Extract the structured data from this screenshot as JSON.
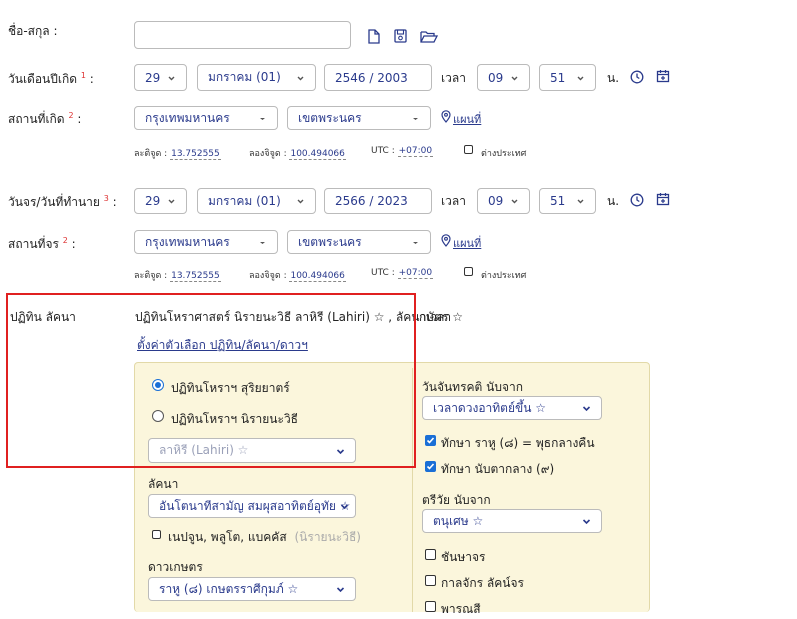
{
  "fullname": {
    "label": "ชื่อ-สกุล :",
    "value": ""
  },
  "birth": {
    "label": "วันเดือนปีเกิด",
    "req": "1",
    "day": "29",
    "month": "มกราคม (01)",
    "year": "2546 / 2003",
    "time_label": "เวลา",
    "hour": "09",
    "minute": "51",
    "unit": "น."
  },
  "birth_place": {
    "label": "สถานที่เกิด",
    "req": "2",
    "province": "กรุงเทพมหานคร",
    "district": "เขตพระนคร",
    "map_link": "แผนที่",
    "lat_label": "ละติจูด :",
    "lat": "13.752555",
    "lon_label": "ลองจิจูด :",
    "lon": "100.494066",
    "utc_label": "UTC :",
    "utc": "+07:00",
    "abroad": "ต่างประเทศ"
  },
  "transit": {
    "label": "วันจร/วันที่ทำนาย",
    "req": "3",
    "day": "29",
    "month": "มกราคม (01)",
    "year": "2566 / 2023",
    "time_label": "เวลา",
    "hour": "09",
    "minute": "51",
    "unit": "น."
  },
  "transit_place": {
    "label": "สถานที่จร",
    "req": "2",
    "province": "กรุงเทพมหานคร",
    "district": "เขตพระนคร",
    "map_link": "แผนที่",
    "lat_label": "ละติจูด :",
    "lat": "13.752555",
    "lon_label": "ลองจิจูด :",
    "lon": "100.494066",
    "utc_label": "UTC :",
    "utc": "+07:00",
    "abroad": "ต่างประเทศ"
  },
  "calendar": {
    "label": "ปฏิทิน ลัคนา",
    "summary": "ปฏิทินโหราศาสตร์ นิรายนะวิธี ลาหิรี (Lahiri) ☆ , ลัคนาเวลาฤกษ์ ☆",
    "summary_left": "ปฏิทินโหราศาสตร์ นิรายนะวิธี ลาหิรี (Lahiri) ☆ , ลัคนาเวลา",
    "summary_right": "กษัตร ☆",
    "settings_link": "ตั้งค่าตัวเลือก ปฏิทิน/ลัคนา/ดาวฯ",
    "radio_tropical": "ปฏิทินโหราฯ สุริยยาตร์",
    "radio_sidereal": "ปฏิทินโหราฯ นิรายนะวิธี",
    "ayanamsa": "ลาหิรี (Lahiri) ☆",
    "ascendant_label": "ลัคนา",
    "ascendant": "อันโตนาทีสามัญ สมผุสอาทิตย์อุทัย ☆",
    "outer_planets": "เนปจูน, พลูโต, แบคคัส",
    "outer_planets_note": "(นิรายนะวิธี)",
    "nakshatra_label": "ดาวเกษตร",
    "nakshatra": "ราหู (๘) เกษตรราศีกุมภ์ ☆"
  },
  "right_panel": {
    "tithi_label": "วันจันทรคติ นับจาก",
    "tithi": "เวลาดวงอาทิตย์ขึ้น ☆",
    "rahu_check": "ทักษา ราหู (๘) = พุธกลางคืน",
    "count_check": "ทักษา นับตากลาง (๙)",
    "trivai_label": "ตรีวัย นับจาก",
    "trivai": "ตนุเศษ ☆",
    "cb1": "ชันษาจร",
    "cb2": "กาลจักร ลัคน์จร",
    "cb3": "พารณสี"
  },
  "colors": {
    "accent": "#1a6fd6",
    "link": "#2a3a8c",
    "panel_bg": "#fbf6dc",
    "highlight": "#e02020"
  }
}
